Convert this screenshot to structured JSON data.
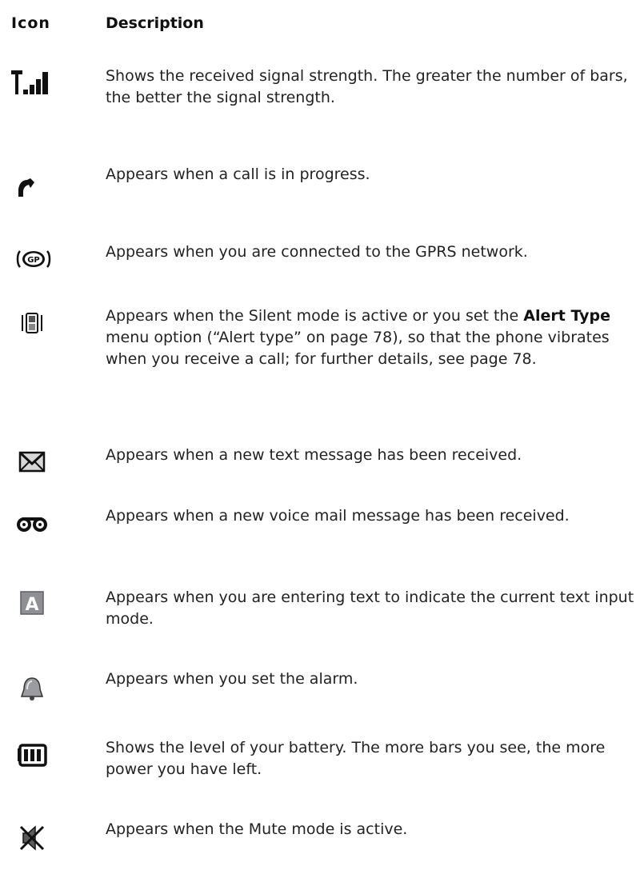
{
  "header": {
    "icon_label": "Icon",
    "description_label": "Description"
  },
  "rows": [
    {
      "icon": "signal-strength-icon",
      "text": "Shows the received signal strength. The greater the number of bars, the better the signal strength."
    },
    {
      "icon": "call-in-progress-icon",
      "text": "Appears when a call is in progress."
    },
    {
      "icon": "gprs-icon",
      "text": "Appears when you are connected to the GPRS network."
    },
    {
      "icon": "vibrate-icon",
      "text_before": "Appears when the Silent mode is active or you set the ",
      "text_bold": "Alert Type",
      "text_after": " menu option (“Alert type” on page 78), so that the phone vibrates when you receive a call; for further details, see page 78."
    },
    {
      "icon": "text-message-icon",
      "text": "Appears when a new text message has been received."
    },
    {
      "icon": "voice-mail-icon",
      "text": "Appears when a new voice mail message has been received."
    },
    {
      "icon": "text-input-mode-icon",
      "text": "Appears when you are entering text to indicate the current text input mode."
    },
    {
      "icon": "alarm-icon",
      "text": "Appears when you set the alarm."
    },
    {
      "icon": "battery-icon",
      "text": "Shows the level of your battery. The more bars you see, the more power you have left."
    },
    {
      "icon": "mute-icon",
      "text": "Appears when the Mute mode is active."
    }
  ]
}
